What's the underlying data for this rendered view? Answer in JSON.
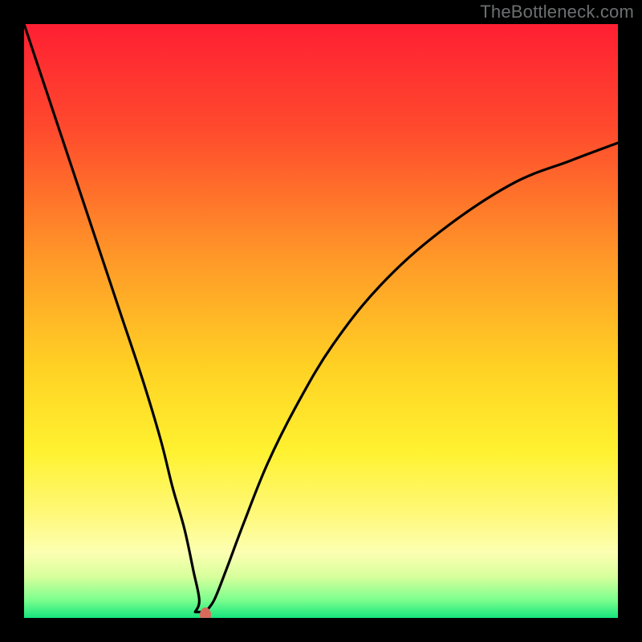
{
  "watermark": "TheBottleneck.com",
  "colors": {
    "frame": "#000000",
    "curve": "#000000",
    "marker": "#d86a5c",
    "gradient_stops": [
      {
        "pct": 0,
        "color": "#ff1f33"
      },
      {
        "pct": 18,
        "color": "#ff4b2d"
      },
      {
        "pct": 40,
        "color": "#ff9a28"
      },
      {
        "pct": 58,
        "color": "#ffd224"
      },
      {
        "pct": 72,
        "color": "#fff230"
      },
      {
        "pct": 82,
        "color": "#fff876"
      },
      {
        "pct": 89,
        "color": "#fcffb2"
      },
      {
        "pct": 93,
        "color": "#d8ff9c"
      },
      {
        "pct": 97,
        "color": "#7bff8e"
      },
      {
        "pct": 100,
        "color": "#16e47c"
      }
    ]
  },
  "chart_data": {
    "type": "line",
    "title": "",
    "xlabel": "",
    "ylabel": "",
    "xlim": [
      0,
      100
    ],
    "ylim": [
      0,
      100
    ],
    "grid": false,
    "legend": false,
    "series": [
      {
        "name": "bottleneck-curve",
        "x": [
          0,
          4,
          8,
          12,
          16,
          20,
          23,
          25,
          27,
          28.5,
          29.5,
          30.5,
          32,
          34,
          37,
          41,
          46,
          52,
          60,
          70,
          82,
          92,
          100
        ],
        "values": [
          100,
          88,
          76,
          64,
          52,
          40,
          30,
          22,
          15,
          8,
          3,
          1,
          3,
          8,
          16,
          26,
          36,
          46,
          56,
          65,
          73,
          77,
          80
        ]
      }
    ],
    "marker": {
      "x": 30.5,
      "y": 0.5
    },
    "flat_bottom": {
      "x_start": 28.8,
      "x_end": 30.5,
      "y": 1.0
    },
    "annotations": []
  }
}
